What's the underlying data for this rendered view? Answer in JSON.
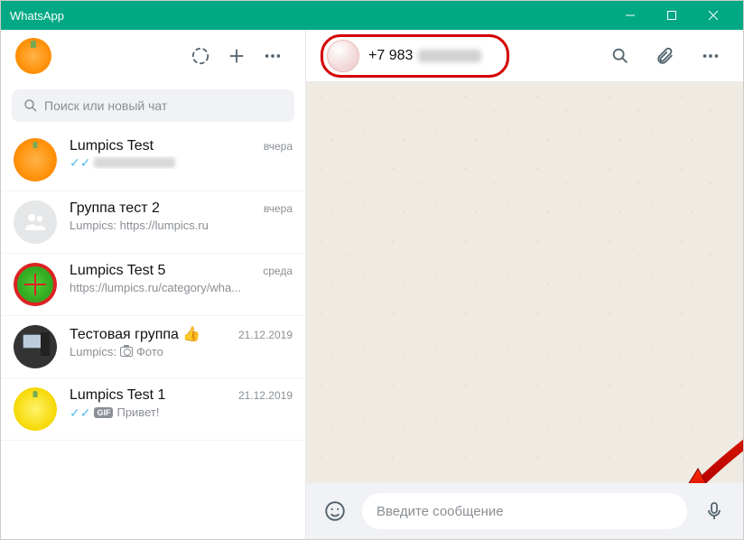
{
  "window": {
    "title": "WhatsApp"
  },
  "sidebar": {
    "search_placeholder": "Поиск или новый чат",
    "chats": [
      {
        "name": "Lumpics Test",
        "time": "вчера",
        "preview": "",
        "ticks": true,
        "blurred_preview": true,
        "avatar": "orange"
      },
      {
        "name": "Группа тест 2",
        "time": "вчера",
        "preview": "Lumpics: https://lumpics.ru",
        "avatar": "group"
      },
      {
        "name": "Lumpics Test 5",
        "time": "среда",
        "preview": "https://lumpics.ru/category/wha...",
        "avatar": "green"
      },
      {
        "name": "Тестовая группа 👍",
        "time": "21.12.2019",
        "preview": "Lumpics: 📷 Фото",
        "avatar": "pc",
        "photo_icon": true,
        "photo_label": "Фото",
        "preview_prefix": "Lumpics:"
      },
      {
        "name": "Lumpics Test 1",
        "time": "21.12.2019",
        "preview": "Привет!",
        "ticks": true,
        "gif": true,
        "avatar": "lemon"
      }
    ]
  },
  "chat": {
    "contact_phone_prefix": "+7 983",
    "input_placeholder": "Введите сообщение"
  },
  "icons": {
    "status": "status-icon",
    "new_chat": "plus-icon",
    "menu": "dots-icon",
    "search": "search-icon",
    "attach": "attach-icon",
    "emoji": "emoji-icon",
    "mic": "mic-icon"
  },
  "colors": {
    "brand": "#00a884",
    "highlight": "#d40000"
  }
}
